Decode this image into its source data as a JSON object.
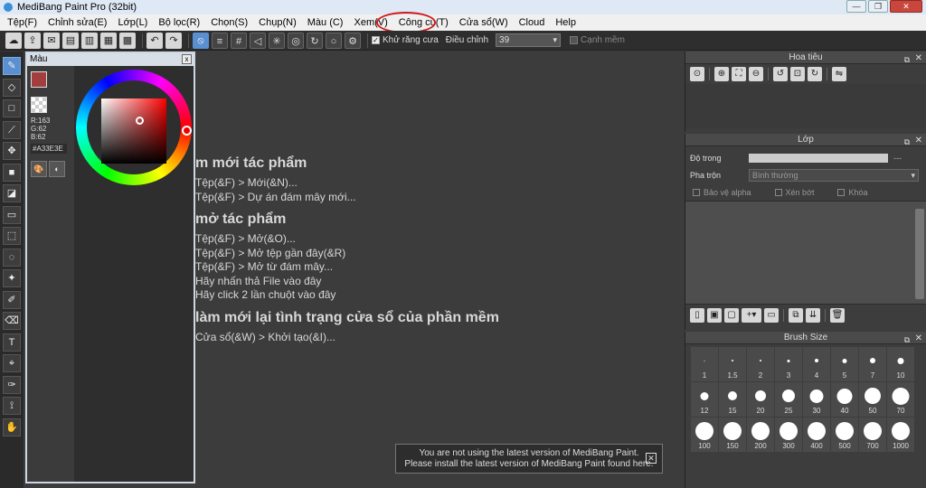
{
  "window": {
    "title": "MediBang Paint Pro (32bit)"
  },
  "menu": [
    "Tệp(F)",
    "Chỉnh sửa(E)",
    "Lớp(L)",
    "Bộ lọc(R)",
    "Chọn(S)",
    "Chụp(N)",
    "Màu (C)",
    "Xem(V)",
    "Công cụ(T)",
    "Cửa sổ(W)",
    "Cloud",
    "Help"
  ],
  "toolbar": {
    "antialias_label": "Khử răng cưa",
    "adjust_label": "Điều chỉnh",
    "adjust_value": "39",
    "edge_label": "Cạnh mềm"
  },
  "color_panel": {
    "title": "Màu",
    "r": "R:163",
    "g": "G:62",
    "b": "B:62",
    "hex": "#A33E3E",
    "foreground": "#a33e3e"
  },
  "welcome": {
    "new_heading": "m mới tác phẩm",
    "new_items": [
      "Tệp(&F) > Mới(&N)...",
      "Tệp(&F) > Dự án đám mây mới..."
    ],
    "open_heading": "mở tác phẩm",
    "open_items": [
      "Tệp(&F) > Mở(&O)...",
      "Tệp(&F) > Mở tệp gần đây(&R)",
      "Tệp(&F) > Mở từ đám mây...",
      "Hãy nhấn thả File vào đây",
      "Hãy click 2 lần chuột vào đây"
    ],
    "reset_heading": "làm mới lại tình trạng cửa sổ của phần mềm",
    "reset_items": [
      "Cửa sổ(&W) > Khởi tạo(&I)..."
    ]
  },
  "notice": {
    "line1": "You are not using the latest version of MediBang Paint.",
    "line2": "Please install the latest version of MediBang Paint found here."
  },
  "navigator": {
    "title": "Hoa tiêu"
  },
  "layer": {
    "title": "Lớp",
    "opacity_label": "Độ trong",
    "opacity_value": "---",
    "blend_label": "Pha trộn",
    "blend_value": "Bình thường",
    "protect_alpha": "Bảo vệ alpha",
    "clipping": "Xén bớt",
    "lock": "Khóa"
  },
  "brush_size": {
    "title": "Brush Size",
    "sizes": [
      "1",
      "1.5",
      "2",
      "3",
      "4",
      "5",
      "7",
      "10",
      "12",
      "15",
      "20",
      "25",
      "30",
      "40",
      "50",
      "70",
      "100",
      "150",
      "200",
      "300",
      "400",
      "500",
      "700",
      "1000"
    ]
  }
}
